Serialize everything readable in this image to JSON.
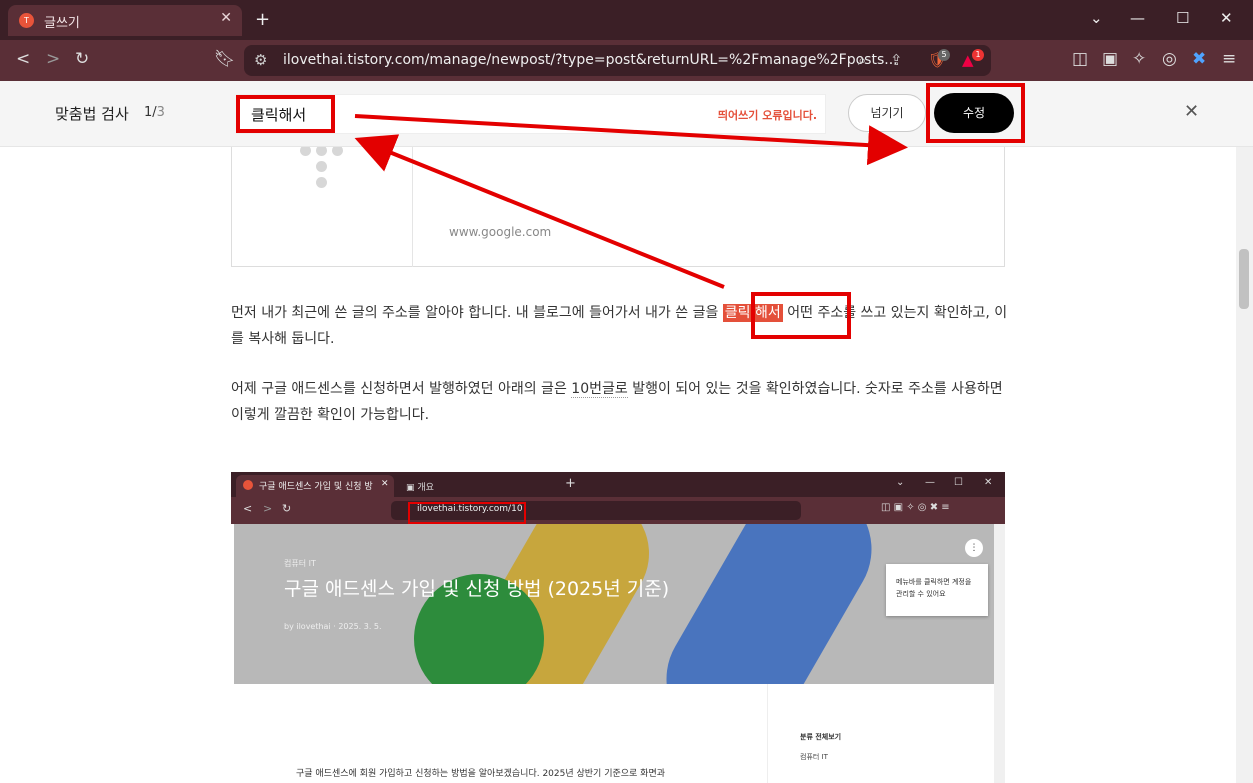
{
  "browser": {
    "tab_title": "글쓰기",
    "url": "ilovethai.tistory.com/manage/newpost/?type=post&returnURL=%2Fmanage%2Fposts...",
    "badge_brave": "5",
    "badge_alert": "1"
  },
  "spellcheck": {
    "title": "맞춤법 검사",
    "count_current": "1/",
    "count_total": "3",
    "word": "클릭해서",
    "error_msg": "띄어쓰기 오류입니다.",
    "skip_label": "넘기기",
    "fix_label": "수정"
  },
  "content": {
    "link_url": "www.google.com",
    "para1_a": "먼저 내가 최근에 쓴 글의 주소를 알아야 합니다. 내 블로그에 들어가서 내가 쓴 글을 ",
    "para1_hl": "클릭 해서",
    "para1_b": " 어떤 주소를 쓰고 있는지 확인하고, 이를 복사해 둡니다.",
    "para2_a": "어제 구글 애드센스를 신청하면서 발행하였던 아래의 글은 ",
    "para2_ul": "10번글로",
    "para2_b": " 발행이 되어 있는 것을 확인하였습니다. 숫자로 주소를 사용하면 이렇게 깔끔한 확인이 가능합니다."
  },
  "screenshot": {
    "tab1": "구글 애드센스 가입 및 신청 방",
    "tab2": "개요",
    "url": "ilovethai.tistory.com/10",
    "category": "컴퓨터 IT",
    "title": "구글 애드센스 가입 및 신청 방법 (2025년 기준)",
    "byline": "by ilovethai · 2025. 3. 5.",
    "tip": "메뉴바를 클릭하면 계정을 관리할 수 있어요",
    "side_all": "분류 전체보기",
    "side_cat": "컴퓨터 IT",
    "body": "구글 애드센스에 회원 가입하고 신청하는 방법을 알아보겠습니다. 2025년 상반기 기준으로 화면과"
  },
  "colors": {
    "annotation": "#e30000",
    "highlight": "#e4503a",
    "chrome": "#5a2f37"
  }
}
